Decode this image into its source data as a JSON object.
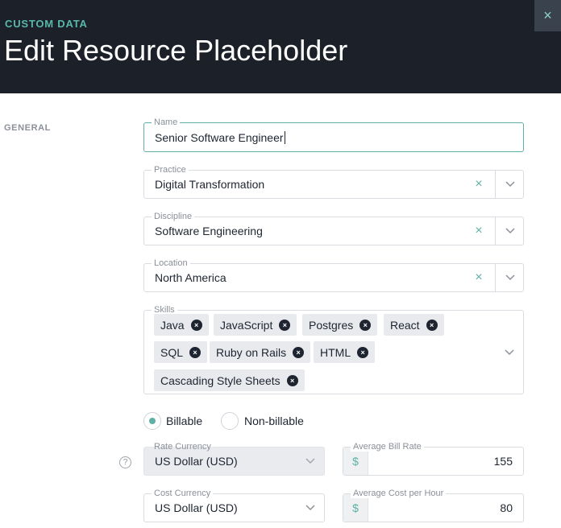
{
  "header": {
    "kicker": "CUSTOM DATA",
    "title": "Edit Resource Placeholder",
    "close_icon": "×"
  },
  "section": {
    "label": "GENERAL"
  },
  "name": {
    "label": "Name",
    "value": "Senior Software Engineer"
  },
  "practice": {
    "label": "Practice",
    "value": "Digital Transformation"
  },
  "discipline": {
    "label": "Discipline",
    "value": "Software Engineering"
  },
  "location": {
    "label": "Location",
    "value": "North America"
  },
  "skills": {
    "label": "Skills",
    "items": [
      "Java",
      "JavaScript",
      "Postgres",
      "React",
      "SQL",
      "Ruby on Rails",
      "HTML",
      "Cascading Style Sheets"
    ]
  },
  "billing": {
    "options": [
      "Billable",
      "Non-billable"
    ],
    "selected": "Billable"
  },
  "rate_currency": {
    "label": "Rate Currency",
    "value": "US Dollar (USD)"
  },
  "avg_bill_rate": {
    "label": "Average Bill Rate",
    "currency_symbol": "$",
    "value": "155"
  },
  "cost_currency": {
    "label": "Cost Currency",
    "value": "US Dollar (USD)"
  },
  "avg_cost": {
    "label": "Average Cost per Hour",
    "currency_symbol": "$",
    "value": "80"
  },
  "help_icon": "?",
  "icons": {
    "clear": "×",
    "chip_remove": "×"
  },
  "colors": {
    "header_bg": "#1c2029",
    "accent": "#5fb0a5",
    "kicker": "#58b8ab"
  }
}
